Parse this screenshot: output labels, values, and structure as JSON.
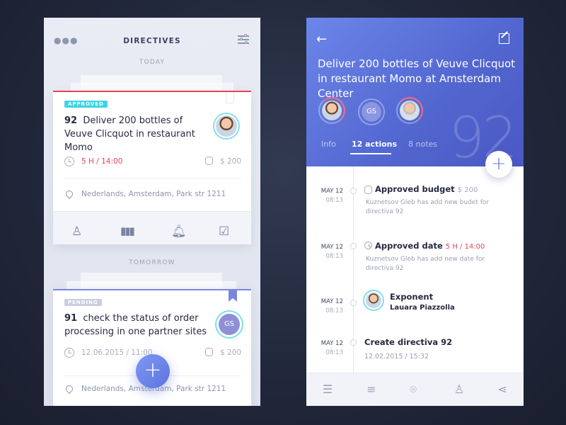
{
  "left": {
    "header": {
      "menu_icon": "more-dots-icon",
      "title": "DIRECTIVES",
      "filter_icon": "filter-sliders-icon"
    },
    "sections": [
      {
        "label": "TODAY"
      },
      {
        "label": "TOMORROW"
      }
    ],
    "cards": [
      {
        "badge": "APPROVED",
        "badge_color": "#3ed5e0",
        "accent_color": "#e8435a",
        "number": "92",
        "title": "Deliver 200 bottles of Veuve Clicquot in restaurant Momo",
        "time": "5 H / 14:00",
        "time_color": "#e8435a",
        "price": "$ 200",
        "address": "Nederlands,  Amsterdam, Park str 1211",
        "actions": [
          "add-person-icon",
          "stats-icon",
          "bell-icon",
          "check-icon"
        ]
      },
      {
        "badge": "PENDING",
        "badge_color": "#c9cde0",
        "accent_color": "#7a86de",
        "number": "91",
        "title": "check the status of order processing in one partner sites",
        "time": "12.06.2015 / 11:00",
        "time_color": "#a9aec2",
        "price": "$ 200",
        "address": "Nederlands,  Amsterdam, Park str 1211",
        "avatar_initials": "GS"
      }
    ],
    "fab_label": "+"
  },
  "right": {
    "header": {
      "back_icon": "back-arrow-icon",
      "edit_icon": "edit-icon",
      "title": "Deliver 200 bottles of Veuve  Clicquot in restaurant Momo at Amsterdam Center",
      "big_number": "92",
      "avatar_initials": "GS"
    },
    "tabs": [
      {
        "label": "Info",
        "active": false
      },
      {
        "label": "12 actions",
        "active": true
      },
      {
        "label": "8 notes",
        "active": false
      }
    ],
    "fab_label": "+",
    "timeline": [
      {
        "date": "MAY 12",
        "time": "08:13",
        "icon": "coins-icon",
        "title": "Approved budget",
        "extra": "$ 200",
        "extra_color": "#a4a9bd",
        "desc": "Kuznetsov Gleb has add new budet for directiva 92"
      },
      {
        "date": "MAY 12",
        "time": "08:13",
        "icon": "clock-icon",
        "title": "Approved date",
        "extra": "5 H / 14:00",
        "extra_color": "#e8435a",
        "desc": "Kuznetsov Gleb has add new date for directiva 92"
      },
      {
        "date": "MAY 12",
        "time": "08:13",
        "icon": "avatar",
        "title": "Exponent",
        "subtitle": "Lauara Piazzolla"
      },
      {
        "date": "MAY 12",
        "time": "08:13",
        "title": "Create directiva 92",
        "desc": "12.02.2015  /  15:32"
      }
    ],
    "bottom_nav": [
      "coins-icon",
      "list-icon",
      "location-pin-icon",
      "add-person-icon",
      "share-icon"
    ]
  }
}
